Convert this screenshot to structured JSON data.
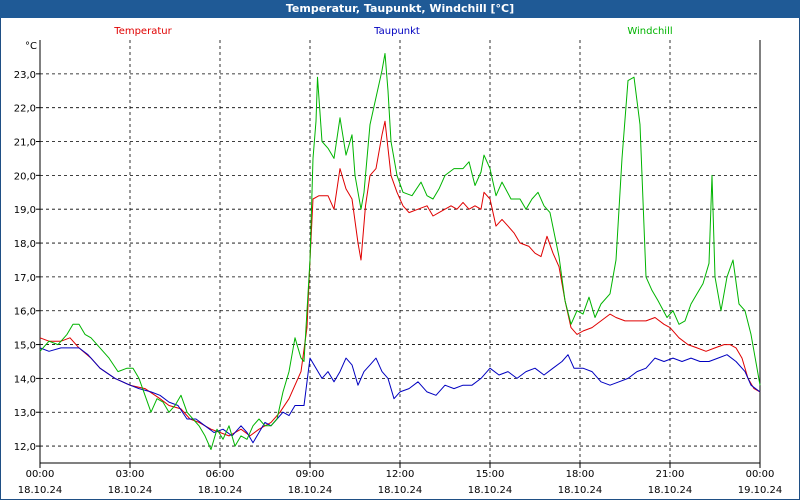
{
  "window": {
    "title": "Temperatur, Taupunkt, Windchill [°C]"
  },
  "chart_data": {
    "type": "line",
    "title": "Temperatur, Taupunkt, Windchill [°C]",
    "ylabel": "°C",
    "xlabel": "",
    "ylim": [
      11.5,
      24.0
    ],
    "y_ticks": [
      "12,0",
      "13,0",
      "14,0",
      "15,0",
      "16,0",
      "17,0",
      "18,0",
      "19,0",
      "20,0",
      "21,0",
      "22,0",
      "23,0"
    ],
    "x_ticks": [
      {
        "time": "00:00",
        "date": "18.10.24"
      },
      {
        "time": "03:00",
        "date": "18.10.24"
      },
      {
        "time": "06:00",
        "date": "18.10.24"
      },
      {
        "time": "09:00",
        "date": "18.10.24"
      },
      {
        "time": "12:00",
        "date": "18.10.24"
      },
      {
        "time": "15:00",
        "date": "18.10.24"
      },
      {
        "time": "18:00",
        "date": "18.10.24"
      },
      {
        "time": "21:00",
        "date": "18.10.24"
      },
      {
        "time": "00:00",
        "date": "19.10.24"
      }
    ],
    "grid": true,
    "legend_placement": "top",
    "series": [
      {
        "name": "Temperatur",
        "color": "#e00000",
        "points": [
          [
            0,
            15.2
          ],
          [
            0.3,
            15.1
          ],
          [
            0.7,
            15.1
          ],
          [
            1.0,
            15.2
          ],
          [
            1.3,
            14.9
          ],
          [
            1.7,
            14.6
          ],
          [
            2.0,
            14.3
          ],
          [
            2.5,
            14.0
          ],
          [
            3.0,
            13.8
          ],
          [
            3.5,
            13.7
          ],
          [
            4.0,
            13.4
          ],
          [
            4.3,
            13.2
          ],
          [
            4.7,
            13.1
          ],
          [
            5.0,
            12.8
          ],
          [
            5.3,
            12.7
          ],
          [
            5.7,
            12.5
          ],
          [
            6.0,
            12.4
          ],
          [
            6.3,
            12.3
          ],
          [
            6.7,
            12.5
          ],
          [
            7.0,
            12.3
          ],
          [
            7.3,
            12.5
          ],
          [
            7.7,
            12.7
          ],
          [
            8.0,
            13.0
          ],
          [
            8.3,
            13.4
          ],
          [
            8.7,
            14.2
          ],
          [
            8.9,
            15.5
          ],
          [
            9.0,
            17.5
          ],
          [
            9.1,
            19.3
          ],
          [
            9.3,
            19.4
          ],
          [
            9.6,
            19.4
          ],
          [
            9.8,
            19.0
          ],
          [
            10.0,
            20.2
          ],
          [
            10.2,
            19.6
          ],
          [
            10.4,
            19.3
          ],
          [
            10.6,
            18.0
          ],
          [
            10.7,
            17.5
          ],
          [
            10.85,
            19.1
          ],
          [
            11.0,
            20.0
          ],
          [
            11.2,
            20.2
          ],
          [
            11.4,
            21.2
          ],
          [
            11.5,
            21.6
          ],
          [
            11.7,
            20.0
          ],
          [
            11.9,
            19.5
          ],
          [
            12.1,
            19.1
          ],
          [
            12.3,
            18.9
          ],
          [
            12.6,
            19.0
          ],
          [
            12.9,
            19.1
          ],
          [
            13.1,
            18.8
          ],
          [
            13.3,
            18.9
          ],
          [
            13.5,
            19.0
          ],
          [
            13.7,
            19.1
          ],
          [
            13.9,
            19.0
          ],
          [
            14.1,
            19.2
          ],
          [
            14.3,
            19.0
          ],
          [
            14.5,
            19.1
          ],
          [
            14.7,
            19.0
          ],
          [
            14.8,
            19.5
          ],
          [
            15.0,
            19.3
          ],
          [
            15.2,
            18.5
          ],
          [
            15.4,
            18.7
          ],
          [
            15.6,
            18.5
          ],
          [
            15.8,
            18.3
          ],
          [
            16.0,
            18.0
          ],
          [
            16.3,
            17.9
          ],
          [
            16.5,
            17.7
          ],
          [
            16.7,
            17.6
          ],
          [
            16.9,
            18.2
          ],
          [
            17.1,
            17.7
          ],
          [
            17.3,
            17.3
          ],
          [
            17.5,
            16.3
          ],
          [
            17.7,
            15.5
          ],
          [
            17.9,
            15.3
          ],
          [
            18.1,
            15.4
          ],
          [
            18.4,
            15.5
          ],
          [
            18.7,
            15.7
          ],
          [
            19.0,
            15.9
          ],
          [
            19.2,
            15.8
          ],
          [
            19.5,
            15.7
          ],
          [
            19.8,
            15.7
          ],
          [
            20.2,
            15.7
          ],
          [
            20.5,
            15.8
          ],
          [
            20.8,
            15.6
          ],
          [
            21.0,
            15.5
          ],
          [
            21.3,
            15.2
          ],
          [
            21.6,
            15.0
          ],
          [
            21.9,
            14.9
          ],
          [
            22.2,
            14.8
          ],
          [
            22.5,
            14.9
          ],
          [
            22.8,
            15.0
          ],
          [
            23.0,
            15.0
          ],
          [
            23.2,
            14.9
          ],
          [
            23.4,
            14.6
          ],
          [
            23.6,
            14.0
          ],
          [
            23.8,
            13.7
          ],
          [
            24.0,
            13.6
          ]
        ]
      },
      {
        "name": "Taupunkt",
        "color": "#0000c0",
        "points": [
          [
            0,
            14.9
          ],
          [
            0.3,
            14.8
          ],
          [
            0.7,
            14.9
          ],
          [
            1.0,
            14.9
          ],
          [
            1.3,
            14.9
          ],
          [
            1.6,
            14.7
          ],
          [
            2.0,
            14.3
          ],
          [
            2.5,
            14.0
          ],
          [
            3.0,
            13.8
          ],
          [
            3.3,
            13.7
          ],
          [
            3.7,
            13.6
          ],
          [
            4.0,
            13.5
          ],
          [
            4.3,
            13.3
          ],
          [
            4.6,
            13.2
          ],
          [
            4.9,
            12.8
          ],
          [
            5.2,
            12.8
          ],
          [
            5.5,
            12.6
          ],
          [
            5.8,
            12.4
          ],
          [
            6.1,
            12.5
          ],
          [
            6.4,
            12.3
          ],
          [
            6.7,
            12.6
          ],
          [
            6.9,
            12.4
          ],
          [
            7.1,
            12.1
          ],
          [
            7.3,
            12.4
          ],
          [
            7.5,
            12.7
          ],
          [
            7.7,
            12.6
          ],
          [
            7.9,
            12.8
          ],
          [
            8.1,
            13.0
          ],
          [
            8.3,
            12.9
          ],
          [
            8.5,
            13.2
          ],
          [
            8.8,
            13.2
          ],
          [
            9.0,
            14.6
          ],
          [
            9.2,
            14.3
          ],
          [
            9.4,
            14.0
          ],
          [
            9.6,
            14.2
          ],
          [
            9.8,
            13.9
          ],
          [
            10.0,
            14.2
          ],
          [
            10.2,
            14.6
          ],
          [
            10.4,
            14.4
          ],
          [
            10.6,
            13.8
          ],
          [
            10.8,
            14.2
          ],
          [
            11.0,
            14.4
          ],
          [
            11.2,
            14.6
          ],
          [
            11.4,
            14.2
          ],
          [
            11.6,
            14.0
          ],
          [
            11.8,
            13.4
          ],
          [
            12.0,
            13.6
          ],
          [
            12.3,
            13.7
          ],
          [
            12.6,
            13.9
          ],
          [
            12.9,
            13.6
          ],
          [
            13.2,
            13.5
          ],
          [
            13.5,
            13.8
          ],
          [
            13.8,
            13.7
          ],
          [
            14.1,
            13.8
          ],
          [
            14.4,
            13.8
          ],
          [
            14.7,
            14.0
          ],
          [
            15.0,
            14.3
          ],
          [
            15.3,
            14.1
          ],
          [
            15.6,
            14.2
          ],
          [
            15.9,
            14.0
          ],
          [
            16.2,
            14.2
          ],
          [
            16.5,
            14.3
          ],
          [
            16.8,
            14.1
          ],
          [
            17.1,
            14.3
          ],
          [
            17.4,
            14.5
          ],
          [
            17.6,
            14.7
          ],
          [
            17.8,
            14.3
          ],
          [
            18.1,
            14.3
          ],
          [
            18.4,
            14.2
          ],
          [
            18.7,
            13.9
          ],
          [
            19.0,
            13.8
          ],
          [
            19.3,
            13.9
          ],
          [
            19.6,
            14.0
          ],
          [
            19.9,
            14.2
          ],
          [
            20.2,
            14.3
          ],
          [
            20.5,
            14.6
          ],
          [
            20.8,
            14.5
          ],
          [
            21.1,
            14.6
          ],
          [
            21.4,
            14.5
          ],
          [
            21.7,
            14.6
          ],
          [
            22.0,
            14.5
          ],
          [
            22.3,
            14.5
          ],
          [
            22.6,
            14.6
          ],
          [
            22.9,
            14.7
          ],
          [
            23.2,
            14.5
          ],
          [
            23.5,
            14.2
          ],
          [
            23.7,
            13.8
          ],
          [
            24.0,
            13.6
          ]
        ]
      },
      {
        "name": "Windchill",
        "color": "#00b400",
        "points": [
          [
            0,
            14.8
          ],
          [
            0.3,
            15.1
          ],
          [
            0.6,
            15.0
          ],
          [
            0.9,
            15.3
          ],
          [
            1.1,
            15.6
          ],
          [
            1.3,
            15.6
          ],
          [
            1.5,
            15.3
          ],
          [
            1.7,
            15.2
          ],
          [
            2.0,
            14.9
          ],
          [
            2.3,
            14.6
          ],
          [
            2.6,
            14.2
          ],
          [
            2.9,
            14.3
          ],
          [
            3.1,
            14.3
          ],
          [
            3.3,
            14.0
          ],
          [
            3.5,
            13.5
          ],
          [
            3.7,
            13.0
          ],
          [
            3.9,
            13.4
          ],
          [
            4.1,
            13.3
          ],
          [
            4.3,
            13.0
          ],
          [
            4.5,
            13.2
          ],
          [
            4.7,
            13.5
          ],
          [
            4.9,
            13.0
          ],
          [
            5.1,
            12.8
          ],
          [
            5.3,
            12.6
          ],
          [
            5.5,
            12.3
          ],
          [
            5.7,
            11.9
          ],
          [
            5.9,
            12.5
          ],
          [
            6.1,
            12.2
          ],
          [
            6.3,
            12.6
          ],
          [
            6.5,
            12.0
          ],
          [
            6.7,
            12.3
          ],
          [
            6.9,
            12.2
          ],
          [
            7.1,
            12.6
          ],
          [
            7.3,
            12.8
          ],
          [
            7.5,
            12.6
          ],
          [
            7.7,
            12.6
          ],
          [
            7.9,
            12.8
          ],
          [
            8.1,
            13.6
          ],
          [
            8.3,
            14.2
          ],
          [
            8.5,
            15.2
          ],
          [
            8.7,
            14.6
          ],
          [
            8.8,
            14.5
          ],
          [
            9.0,
            17.5
          ],
          [
            9.1,
            20.5
          ],
          [
            9.2,
            21.6
          ],
          [
            9.25,
            22.9
          ],
          [
            9.4,
            21.0
          ],
          [
            9.6,
            20.8
          ],
          [
            9.8,
            20.5
          ],
          [
            10.0,
            21.7
          ],
          [
            10.2,
            20.6
          ],
          [
            10.4,
            21.2
          ],
          [
            10.5,
            20.0
          ],
          [
            10.7,
            19.0
          ],
          [
            10.8,
            19.5
          ],
          [
            11.0,
            21.5
          ],
          [
            11.2,
            22.3
          ],
          [
            11.4,
            23.1
          ],
          [
            11.5,
            23.6
          ],
          [
            11.6,
            22.5
          ],
          [
            11.7,
            21.0
          ],
          [
            11.9,
            20.0
          ],
          [
            12.1,
            19.5
          ],
          [
            12.4,
            19.4
          ],
          [
            12.7,
            19.8
          ],
          [
            12.9,
            19.4
          ],
          [
            13.1,
            19.3
          ],
          [
            13.3,
            19.6
          ],
          [
            13.5,
            20.0
          ],
          [
            13.8,
            20.2
          ],
          [
            14.1,
            20.2
          ],
          [
            14.3,
            20.4
          ],
          [
            14.5,
            19.7
          ],
          [
            14.7,
            20.1
          ],
          [
            14.8,
            20.6
          ],
          [
            15.0,
            20.2
          ],
          [
            15.2,
            19.4
          ],
          [
            15.4,
            19.8
          ],
          [
            15.7,
            19.3
          ],
          [
            16.0,
            19.3
          ],
          [
            16.2,
            19.0
          ],
          [
            16.4,
            19.3
          ],
          [
            16.6,
            19.5
          ],
          [
            16.8,
            19.1
          ],
          [
            17.0,
            18.9
          ],
          [
            17.3,
            17.6
          ],
          [
            17.5,
            16.3
          ],
          [
            17.7,
            15.6
          ],
          [
            17.9,
            16.0
          ],
          [
            18.1,
            15.9
          ],
          [
            18.3,
            16.4
          ],
          [
            18.5,
            15.8
          ],
          [
            18.7,
            16.2
          ],
          [
            19.0,
            16.5
          ],
          [
            19.2,
            17.5
          ],
          [
            19.4,
            20.5
          ],
          [
            19.6,
            22.8
          ],
          [
            19.8,
            22.9
          ],
          [
            20.0,
            21.5
          ],
          [
            20.2,
            17.0
          ],
          [
            20.4,
            16.6
          ],
          [
            20.6,
            16.3
          ],
          [
            20.9,
            15.8
          ],
          [
            21.1,
            16.0
          ],
          [
            21.3,
            15.6
          ],
          [
            21.5,
            15.7
          ],
          [
            21.7,
            16.2
          ],
          [
            21.9,
            16.5
          ],
          [
            22.1,
            16.8
          ],
          [
            22.3,
            17.4
          ],
          [
            22.4,
            20.0
          ],
          [
            22.5,
            17.0
          ],
          [
            22.7,
            16.0
          ],
          [
            22.9,
            17.0
          ],
          [
            23.1,
            17.5
          ],
          [
            23.3,
            16.2
          ],
          [
            23.5,
            16.0
          ],
          [
            23.7,
            15.3
          ],
          [
            23.9,
            14.3
          ],
          [
            24.0,
            13.8
          ]
        ]
      }
    ]
  }
}
